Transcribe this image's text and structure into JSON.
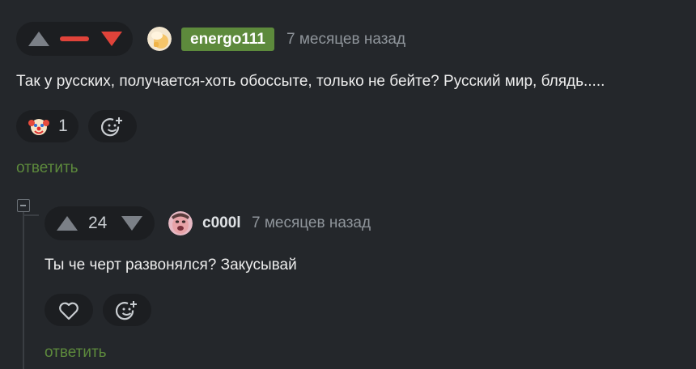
{
  "comments": [
    {
      "author": "energo111",
      "time": "7 месяцев назад",
      "text": "Так у русских, получается-хоть обоссыте, только не бейте? Русский мир, блядь.....",
      "reaction_count": "1",
      "reply_label": "ответить",
      "rating_color": "#e0433a"
    },
    {
      "author": "c000l",
      "time": "7 месяцев назад",
      "text": "Ты че черт развонялся? Закусывай",
      "rating": "24",
      "reply_label": "ответить"
    }
  ],
  "icons": {
    "upvote": "triangle-up",
    "downvote": "triangle-down",
    "reaction": "clown-emoji",
    "add_reaction": "smiley-plus",
    "like": "heart",
    "collapse": "minus-square"
  },
  "colors": {
    "background": "#24272b",
    "accent_green": "#5d8a3c",
    "downvote_red": "#e0433a",
    "muted": "#8f959b"
  }
}
